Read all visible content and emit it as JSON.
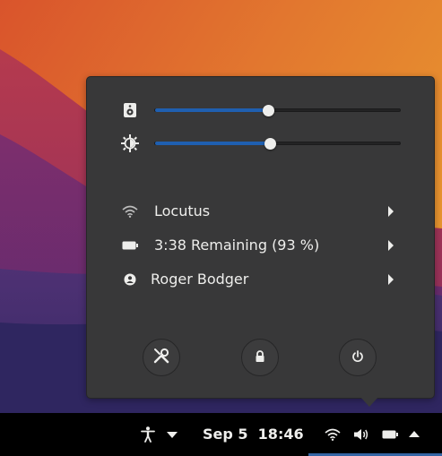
{
  "colors": {
    "accent": "#1f5fb0",
    "menu_bg": "#383839",
    "topbar_bg": "#000000",
    "text": "#eeeeec",
    "active_indicator": "#3465a4"
  },
  "sliders": {
    "volume": {
      "icon": "speaker-icon",
      "value_percent": 46
    },
    "brightness": {
      "icon": "brightness-icon",
      "value_percent": 47
    }
  },
  "menu": {
    "items": [
      {
        "icon": "wifi-icon",
        "label": "Locutus"
      },
      {
        "icon": "battery-icon",
        "label": "3:38 Remaining (93 %)"
      },
      {
        "icon": "user-icon",
        "label": "Roger Bodger"
      }
    ],
    "buttons": [
      {
        "icon": "settings-icon"
      },
      {
        "icon": "lock-icon"
      },
      {
        "icon": "power-icon"
      }
    ]
  },
  "topbar": {
    "date": "Sep 5",
    "time": "18:46",
    "status_icons": [
      "accessibility-icon",
      "dropdown-arrow-icon",
      "wifi-icon",
      "volume-icon",
      "battery-icon",
      "system-menu-arrow-icon"
    ]
  }
}
